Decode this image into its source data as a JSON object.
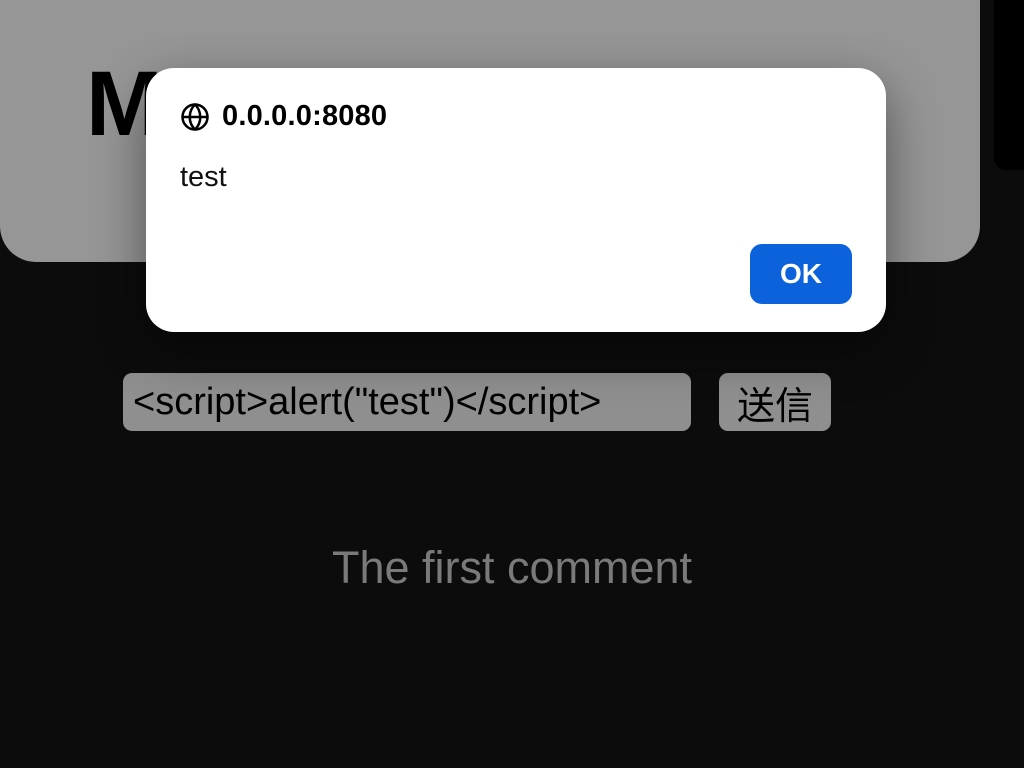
{
  "page": {
    "bg_title": "My Keyed",
    "input_value": "<script>alert(\"test\")</script>",
    "submit_label": "送信",
    "comment_text": "The first comment"
  },
  "dialog": {
    "host": "0.0.0.0:8080",
    "message": "test",
    "ok_label": "OK"
  }
}
